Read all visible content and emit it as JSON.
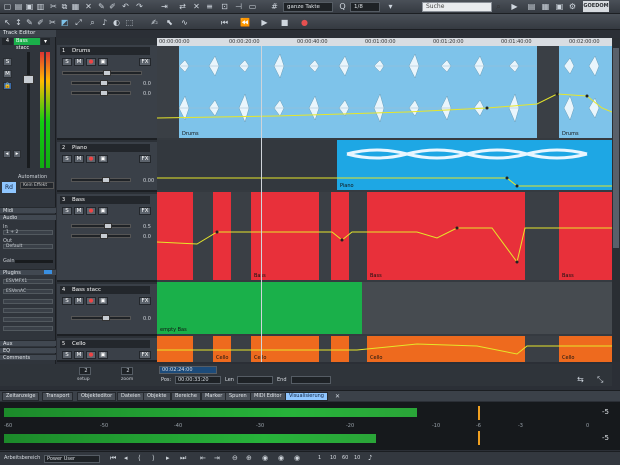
{
  "toolbar": {
    "grid_dropdown": "ganze Takte",
    "quant_dropdown": "1/8",
    "search_placeholder": "Suche",
    "brand": "GOEDOM"
  },
  "left_panel": {
    "title": "Track Editor",
    "track_field": "Bass stacc",
    "automation_label": "Automation",
    "rd_button": "Rd",
    "sections": {
      "midi": "Midi",
      "audio": "Audio",
      "plugins": "Plugins",
      "aux": "Aux",
      "eq": "EQ",
      "comments": "Comments"
    },
    "audio_in_label": "In",
    "audio_in_value": "1 + 2",
    "audio_out_label": "Out",
    "audio_out_value": "Default",
    "gain_label": "Gain",
    "plugin_slots": [
      "ESVMFX1",
      "ESVenAC",
      "",
      "",
      "",
      "",
      ""
    ],
    "icon_buttons": [
      "S",
      "M",
      "L"
    ]
  },
  "tracks": [
    {
      "num": "1",
      "name": "Drums",
      "color": "#7ec3ea",
      "vol": "0.0",
      "pan": "0.0"
    },
    {
      "num": "2",
      "name": "Piano",
      "color": "#1ea7e4",
      "vol": "0.00",
      "pan": ""
    },
    {
      "num": "3",
      "name": "Bass",
      "color": "#e8303a",
      "vol": "0.5",
      "pan": "0.0"
    },
    {
      "num": "4",
      "name": "Bass stacc",
      "color": "#1ab04a",
      "vol": "0.0",
      "pan": ""
    },
    {
      "num": "5",
      "name": "Cello",
      "color": "#ee6a1e",
      "vol": "",
      "pan": ""
    }
  ],
  "track_buttons": {
    "s": "S",
    "m": "M",
    "fx": "FX"
  },
  "ruler_labels": [
    "00:00:00:00",
    "00:00:20:00",
    "00:00:40:00",
    "00:01:00:00",
    "00:01:20:00",
    "00:01:40:00",
    "00:02:00:00"
  ],
  "clip_labels": {
    "drums_a": "Drums",
    "drums_b": "Drums",
    "piano": "Piano",
    "bass": "Bass",
    "bass_stacc": "empty Bas",
    "cello": "Cello"
  },
  "transport_fields": {
    "marker_value": "00:02:24:00",
    "pos_label": "Pos:",
    "pos_value": "00:00:33:20",
    "len_label": "Len",
    "end_label": "End",
    "setup_left": "2",
    "setup_left_label": "setup",
    "setup_right": "2",
    "setup_right_label": "zoom"
  },
  "tabs": [
    "Zeitanzeige",
    "Transport",
    "Objekteditor",
    "Dateien",
    "Objekte",
    "Bereiche",
    "Marker",
    "Spuren",
    "MIDI Editor",
    "Visualisierung"
  ],
  "active_tab": "Visualisierung",
  "meter": {
    "scale": [
      "-60",
      "-50",
      "-40",
      "-30",
      "-20",
      "-10",
      "-6",
      "-3",
      "0"
    ],
    "left_peak": "-5",
    "right_peak": "-5",
    "level_top": 0.7,
    "level_bottom": 0.63
  },
  "status": {
    "mode_label": "Arbeitsbereich",
    "mode_value": "Power User",
    "zoom_labels": [
      "1",
      "10",
      "60",
      "10"
    ]
  }
}
